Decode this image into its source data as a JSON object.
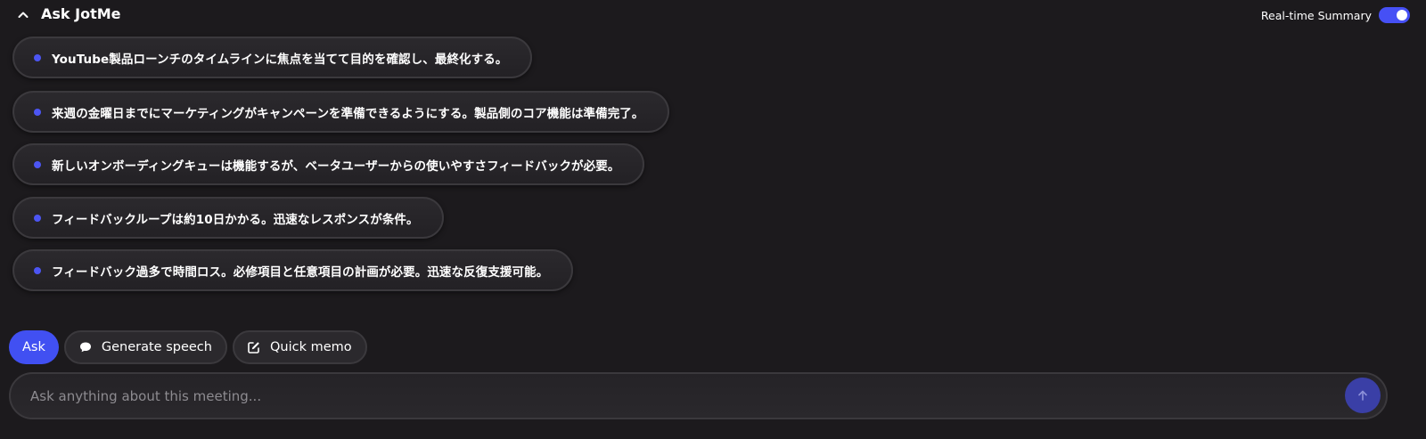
{
  "header": {
    "title": "Ask JotMe",
    "collapse_icon": "chevron-up-icon",
    "realtime_summary": {
      "label": "Real-time Summary",
      "enabled": true
    }
  },
  "summary": {
    "items": [
      {
        "text": "YouTube製品ローンチのタイムラインに焦点を当てて目的を確認し、最終化する。"
      },
      {
        "text": "来週の金曜日までにマーケティングがキャンペーンを準備できるようにする。製品側のコア機能は準備完了。"
      },
      {
        "text": "新しいオンボーディングキューは機能するが、ベータユーザーからの使いやすさフィードバックが必要。"
      },
      {
        "text": "フィードバックループは約10日かかる。迅速なレスポンスが条件。"
      },
      {
        "text": "フィードバック過多で時間ロス。必修項目と任意項目の計画が必要。迅速な反復支援可能。"
      }
    ]
  },
  "actions": {
    "ask_label": "Ask",
    "generate_speech_label": "Generate speech",
    "generate_speech_icon": "speech-bubble-icon",
    "quick_memo_label": "Quick memo",
    "quick_memo_icon": "edit-note-icon"
  },
  "input": {
    "placeholder": "Ask anything about this meeting...",
    "value": "",
    "send_icon": "arrow-up-icon"
  },
  "colors": {
    "background": "#1c1a1d",
    "accent": "#4150f2",
    "bullet": "#4c55f2",
    "send_button": "#3a3fa6"
  }
}
